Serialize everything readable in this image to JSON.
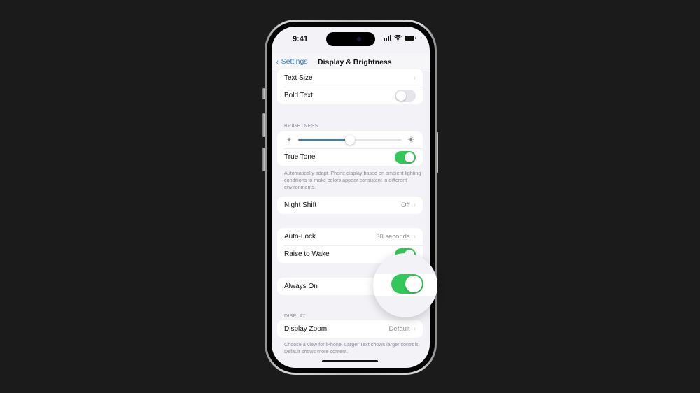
{
  "status_bar": {
    "time": "9:41"
  },
  "nav": {
    "back_label": "Settings",
    "title": "Display & Brightness"
  },
  "appearance_group": {
    "text_size": {
      "label": "Text Size"
    },
    "bold_text": {
      "label": "Bold Text",
      "on": false
    }
  },
  "brightness": {
    "header": "BRIGHTNESS",
    "level_percent": 50,
    "true_tone": {
      "label": "True Tone",
      "on": true
    },
    "footnote": "Automatically adapt iPhone display based on ambient lighting conditions to make colors appear consistent in different environments."
  },
  "night_shift": {
    "label": "Night Shift",
    "value": "Off"
  },
  "lock_group": {
    "auto_lock": {
      "label": "Auto-Lock",
      "value": "30 seconds"
    },
    "raise_to_wake": {
      "label": "Raise to Wake",
      "on": true
    }
  },
  "always_on": {
    "label": "Always On",
    "on": true
  },
  "display": {
    "header": "DISPLAY",
    "zoom": {
      "label": "Display Zoom",
      "value": "Default"
    },
    "footnote": "Choose a view for iPhone. Larger Text shows larger controls. Default shows more content."
  },
  "icons": {
    "back": "‹",
    "chevron": "›",
    "sun": "☀"
  },
  "colors": {
    "accent": "#2f80e6",
    "toggle_on": "#34c759",
    "background": "#f2f2f7"
  }
}
